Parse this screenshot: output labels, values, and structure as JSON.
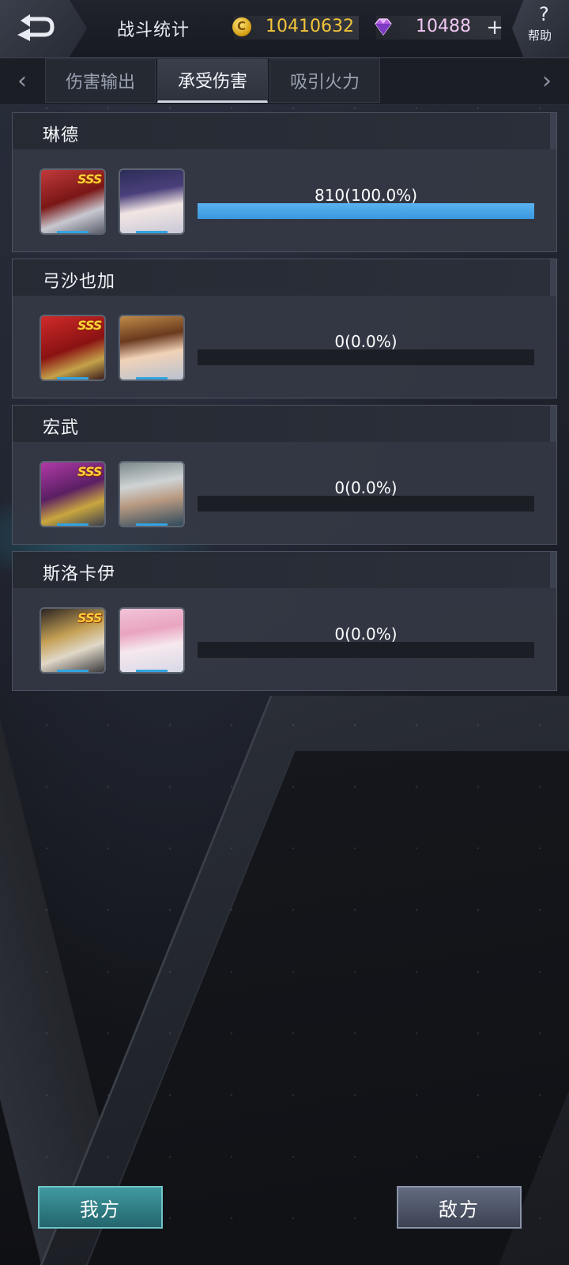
{
  "header": {
    "title": "战斗统计",
    "gold": "10410632",
    "gems": "10488",
    "plus": "+",
    "help_q": "?",
    "help_label": "帮助"
  },
  "tabs": [
    {
      "label": "伤害输出",
      "active": false
    },
    {
      "label": "承受伤害",
      "active": true
    },
    {
      "label": "吸引火力",
      "active": false
    }
  ],
  "units": [
    {
      "name": "琳德",
      "badge": "SSS",
      "value_text": "810(100.0%)",
      "share": 1.0
    },
    {
      "name": "弓沙也加",
      "badge": "SSS",
      "value_text": "0(0.0%)",
      "share": 0.0
    },
    {
      "name": "宏武",
      "badge": "SSS",
      "value_text": "0(0.0%)",
      "share": 0.0
    },
    {
      "name": "斯洛卡伊",
      "badge": "SSS",
      "value_text": "0(0.0%)",
      "share": 0.0
    }
  ],
  "footer": {
    "ours_label": "我方",
    "enemy_label": "敌方"
  },
  "colors": {
    "gold_text": "#f4c53a",
    "gem_text": "#f1c8f4",
    "bar_fill": "#3a98de"
  }
}
